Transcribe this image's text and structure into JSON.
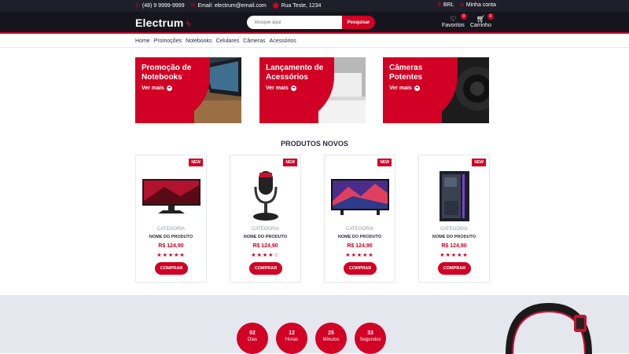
{
  "topbar": {
    "phone": "(48) 9 9999-9999",
    "email": "Email: electrum@email.com",
    "address": "Rua Teste, 1234",
    "currency": "BRL",
    "account": "Minha conta"
  },
  "header": {
    "logo": "Electrum",
    "search_placeholder": "Busque aqui",
    "search_button": "Pesquisar",
    "favorites_label": "Favoritos",
    "favorites_count": "0",
    "cart_label": "Carrinho",
    "cart_count": "0"
  },
  "nav": [
    "Home",
    "Promoções",
    "Notebooks",
    "Celulares",
    "Câmeras",
    "Acessórios"
  ],
  "banners": [
    {
      "title": "Promoção de Notebooks",
      "link": "Ver mais"
    },
    {
      "title": "Lançamento de Acessórios",
      "link": "Ver mais"
    },
    {
      "title": "Câmeras Potentes",
      "link": "Ver mais"
    }
  ],
  "section_title": "PRODUTOS NOVOS",
  "products": [
    {
      "badge": "NEW",
      "category": "CATEGORIA",
      "name": "NOME DO PRODUTO",
      "price": "R$ 124,90",
      "rating": 5,
      "buy": "COMPRAR",
      "image": "monitor-image"
    },
    {
      "badge": "NEW",
      "category": "CATEGORIA",
      "name": "NOME DO PRODUTO",
      "price": "R$ 124,90",
      "rating": 4,
      "buy": "COMPRAR",
      "image": "microphone-image"
    },
    {
      "badge": "NEW",
      "category": "CATEGORIA",
      "name": "NOME DO PRODUTO",
      "price": "R$ 124,90",
      "rating": 5,
      "buy": "COMPRAR",
      "image": "tv-image"
    },
    {
      "badge": "NEW",
      "category": "CATEGORIA",
      "name": "NOME DO PRODUTO",
      "price": "R$ 124,90",
      "rating": 5,
      "buy": "COMPRAR",
      "image": "pc-case-image"
    }
  ],
  "countdown": [
    {
      "value": "02",
      "label": "Dias"
    },
    {
      "value": "12",
      "label": "Horas"
    },
    {
      "value": "25",
      "label": "Minutos"
    },
    {
      "value": "33",
      "label": "Segundos"
    }
  ],
  "colors": {
    "accent": "#D10024",
    "dark": "#15161d",
    "topbar": "#1e1f29"
  }
}
